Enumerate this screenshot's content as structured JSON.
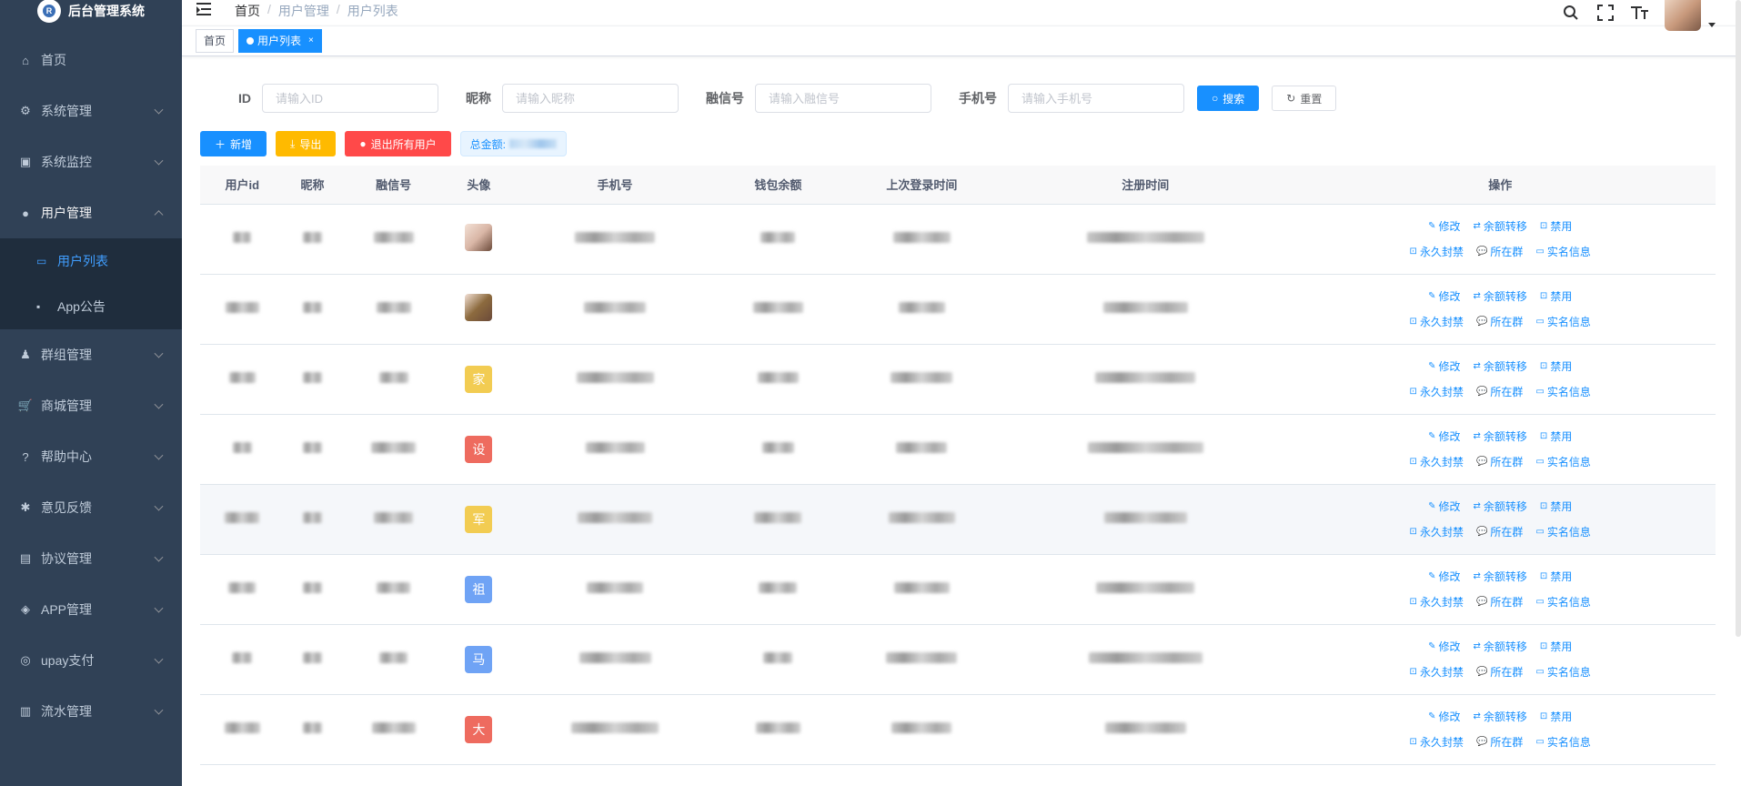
{
  "app": {
    "title": "后台管理系统",
    "logo_letter": "R"
  },
  "sidebar": {
    "items": [
      {
        "label": "首页",
        "icon": "home-icon",
        "glyph": "⌂",
        "has_arrow": false
      },
      {
        "label": "系统管理",
        "icon": "gear-icon",
        "glyph": "⚙",
        "has_arrow": true
      },
      {
        "label": "系统监控",
        "icon": "monitor-icon",
        "glyph": "▣",
        "has_arrow": true
      },
      {
        "label": "用户管理",
        "icon": "user-icon",
        "glyph": "●",
        "has_arrow": true,
        "open": true
      },
      {
        "label": "群组管理",
        "icon": "group-icon",
        "glyph": "♟",
        "has_arrow": true
      },
      {
        "label": "商城管理",
        "icon": "cart-icon",
        "glyph": "🛒",
        "has_arrow": true
      },
      {
        "label": "帮助中心",
        "icon": "help-icon",
        "glyph": "?",
        "has_arrow": true
      },
      {
        "label": "意见反馈",
        "icon": "bug-icon",
        "glyph": "✱",
        "has_arrow": true
      },
      {
        "label": "协议管理",
        "icon": "document-icon",
        "glyph": "▤",
        "has_arrow": true
      },
      {
        "label": "APP管理",
        "icon": "cube-icon",
        "glyph": "◈",
        "has_arrow": true
      },
      {
        "label": "upay支付",
        "icon": "pay-icon",
        "glyph": "◎",
        "has_arrow": true
      },
      {
        "label": "流水管理",
        "icon": "flow-icon",
        "glyph": "▥",
        "has_arrow": true
      }
    ],
    "submenu": [
      {
        "label": "用户列表",
        "icon": "list-icon",
        "active": true
      },
      {
        "label": "App公告",
        "icon": "message-icon",
        "active": false
      }
    ]
  },
  "breadcrumb": {
    "home": "首页",
    "parent": "用户管理",
    "current": "用户列表",
    "separator": "/"
  },
  "tags": {
    "home": "首页",
    "active": "用户列表",
    "close": "×"
  },
  "search": {
    "id_label": "ID",
    "id_placeholder": "请输入ID",
    "nickname_label": "昵称",
    "nickname_placeholder": "请输入昵称",
    "rongxin_label": "融信号",
    "rongxin_placeholder": "请输入融信号",
    "phone_label": "手机号",
    "phone_placeholder": "请输入手机号",
    "search_button": "搜索",
    "reset_button": "重置"
  },
  "toolbar": {
    "add": "新增",
    "export": "导出",
    "logout_all": "退出所有用户",
    "total_label": "总金额:"
  },
  "table": {
    "headers": [
      "用户id",
      "昵称",
      "融信号",
      "头像",
      "手机号",
      "钱包余额",
      "上次登录时间",
      "注册时间",
      "操作"
    ],
    "ops_row1": [
      "修改",
      "余额转移",
      "禁用"
    ],
    "ops_row2": [
      "永久封禁",
      "所在群",
      "实名信息"
    ],
    "rows": [
      {
        "avatar_type": "photo",
        "avatar_text": "",
        "avatar_color": "#d9b6a6"
      },
      {
        "avatar_type": "photo",
        "avatar_text": "",
        "avatar_color": "#8c6a3e"
      },
      {
        "avatar_type": "text",
        "avatar_text": "家",
        "avatar_color": "#f2cc52"
      },
      {
        "avatar_type": "text",
        "avatar_text": "设",
        "avatar_color": "#ee6b5f"
      },
      {
        "avatar_type": "text",
        "avatar_text": "军",
        "avatar_color": "#f2cc52"
      },
      {
        "avatar_type": "text",
        "avatar_text": "祖",
        "avatar_color": "#6fa3f5"
      },
      {
        "avatar_type": "text",
        "avatar_text": "马",
        "avatar_color": "#6fa3f5"
      },
      {
        "avatar_type": "text",
        "avatar_text": "大",
        "avatar_color": "#ee6b5f"
      }
    ]
  },
  "colors": {
    "sidebar_bg": "#304156",
    "primary": "#1890ff",
    "warning": "#ffba00",
    "danger": "#ff4949"
  }
}
